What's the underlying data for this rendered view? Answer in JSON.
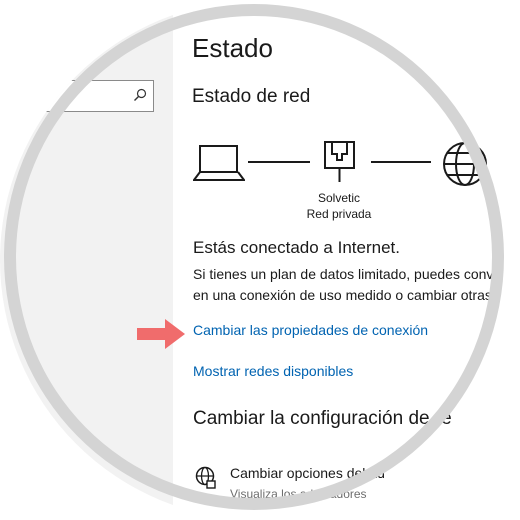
{
  "page": {
    "title": "Estado",
    "section_title": "Estado de red"
  },
  "network_diagram": {
    "router_name": "Solvetic",
    "router_type": "Red privada"
  },
  "status": {
    "heading": "Estás conectado a Internet.",
    "desc_line1": "Si tienes un plan de datos limitado, puedes conv",
    "desc_line2": "en una conexión de uso medido o cambiar otras"
  },
  "links": {
    "change_properties": "Cambiar las propiedades de conexión",
    "show_networks": "Mostrar redes disponibles"
  },
  "config": {
    "heading": "Cambiar la configuración de re",
    "adapter_title": "Cambiar opciones del ad",
    "adapter_desc": "Visualiza los adaptadores"
  },
  "colors": {
    "accent": "#0063b1",
    "arrow": "#f06c6c",
    "sidebar_bg": "#f2f2f2"
  },
  "icons": [
    "search-icon",
    "laptop-icon",
    "router-icon",
    "globe-icon",
    "arrow-icon",
    "adapter-icon"
  ]
}
